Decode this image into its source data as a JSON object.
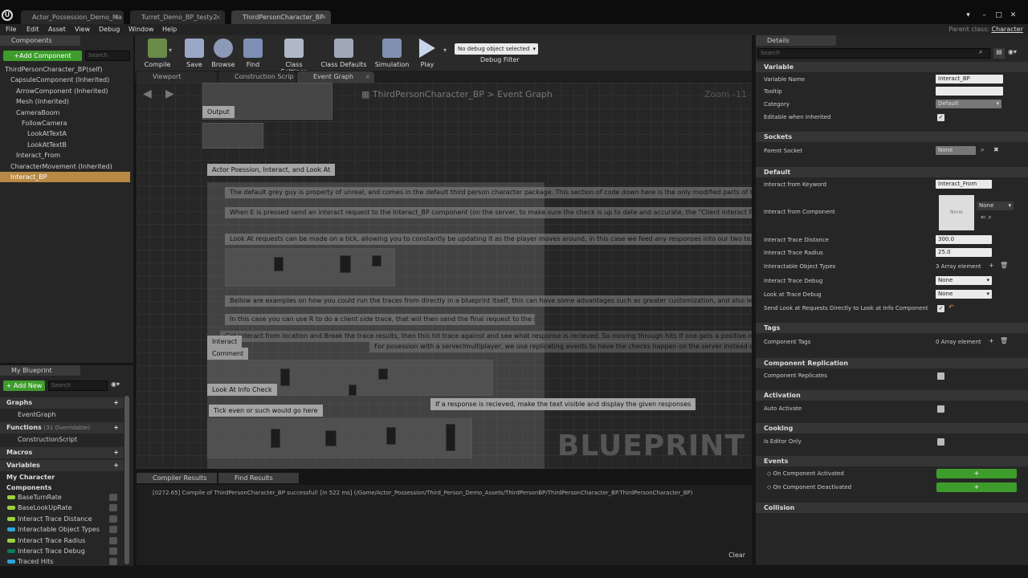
{
  "window": {
    "tabs": [
      "Actor_Possession_Demo_Ma",
      "Turret_Demo_BP_testy2",
      "ThirdPersonCharacter_BP"
    ],
    "active_tab": 2
  },
  "menu": {
    "items": [
      "File",
      "Edit",
      "Asset",
      "View",
      "Debug",
      "Window",
      "Help"
    ],
    "parent_class_label": "Parent class:",
    "parent_class_value": "Character"
  },
  "components": {
    "tab_label": "Components",
    "add_label": "+Add Component",
    "search_placeholder": "Search",
    "items": [
      {
        "label": "ThirdPersonCharacter_BP(self)",
        "indent": 0
      },
      {
        "label": "CapsuleComponent (Inherited)",
        "indent": 1
      },
      {
        "label": "ArrowComponent (Inherited)",
        "indent": 2
      },
      {
        "label": "Mesh (Inherited)",
        "indent": 2
      },
      {
        "label": "CameraBoom",
        "indent": 2
      },
      {
        "label": "FollowCamera",
        "indent": 3
      },
      {
        "label": "LookAtTextA",
        "indent": 4
      },
      {
        "label": "LookAtTextB",
        "indent": 4
      },
      {
        "label": "Interact_From",
        "indent": 2
      },
      {
        "label": "CharacterMovement (Inherited)",
        "indent": 1
      },
      {
        "label": "Interact_BP",
        "indent": 1
      }
    ],
    "selected": 10
  },
  "toolbar": {
    "buttons": [
      "Compile",
      "Save",
      "Browse",
      "Find",
      "Class Settings",
      "Class Defaults",
      "Simulation",
      "Play"
    ],
    "debug_select": "No debug object selected",
    "debug_filter": "Debug Filter"
  },
  "graph_tabs": [
    "Viewport",
    "Construction Scrip",
    "Event Graph"
  ],
  "graph": {
    "breadcrumb_root": "ThirdPersonCharacter_BP",
    "breadcrumb_leaf": "Event Graph",
    "zoom": "Zoom -11",
    "watermark": "BLUEPRINT",
    "comments": {
      "output": "Output",
      "main_title": "Actor Poession, Interact, and Look At",
      "desc1": "The default grey guy is property of unreal, and comes in the default third person character package. This section of code down here is the only modified parts of this actor o",
      "desc2": "When E is pressed send an interact request to the Interact_BP component (on the server, to make sure the check is up to date and accurate, the \"Client Interact Request\" ev",
      "desc3": "Look At requests can be made on a tick, allowing you to constantly be updating it as the player moves around, in this case we feed any responses into our two text",
      "desc4": "Bellow are examples on how you could run the traces from directly in a blueprint itself, this can have some advantages such as greater customization, and also letting you",
      "desc5": "In this case you can use R to do a client side trace, that will then send the final request to the server.",
      "desc6": "Get interact from location and Break the trace results, then this hit trace against and see what response is recieved. So moving through hits if one gets a positive re",
      "desc7": "For posession with a server/multiplayer, we use replicating events to have the checks happen on the server instead of the c",
      "interact": "Interact",
      "comment": "Comment",
      "look_at": "Look At Info Check",
      "tick": "Tick even or such would go here",
      "response": "If a response is recieved, make the text visible and display the given responses"
    }
  },
  "bottom": {
    "tabs": [
      "Compiler Results",
      "Find Results"
    ],
    "log": "[0272.65] Compile of ThirdPersonCharacter_BP successful! [in 522 ms] (/Game/Actor_Possession/Third_Person_Demo_Assets/ThirdPersonBP/ThirdPersonCharacter_BP.ThirdPersonCharacter_BP)",
    "clear": "Clear"
  },
  "my_blueprint": {
    "tab_label": "My Blueprint",
    "add_label": "+ Add New",
    "search_placeholder": "Search",
    "graphs_label": "Graphs",
    "event_graph": "EventGraph",
    "functions_label": "Functions",
    "functions_count": "(31 Overridable)",
    "construction_script": "ConstructionScript",
    "macros_label": "Macros",
    "variables_label": "Variables",
    "my_character": "My Character",
    "components_label": "Components",
    "variables": [
      {
        "label": "BaseTurnRate",
        "color": "#9bd23a"
      },
      {
        "label": "BaseLookUpRate",
        "color": "#9bd23a"
      },
      {
        "label": "Interact Trace Distance",
        "color": "#9bd23a"
      },
      {
        "label": "Interactable Object Types",
        "color": "#2aa7d6"
      },
      {
        "label": "Interact Trace Radius",
        "color": "#9bd23a"
      },
      {
        "label": "Interact Trace Debug",
        "color": "#0a7a5a"
      },
      {
        "label": "Traced Hits",
        "color": "#2aa7d6"
      }
    ]
  },
  "details": {
    "tab_label": "Details",
    "search_placeholder": "Search",
    "variable": {
      "title": "Variable",
      "name_label": "Variable Name",
      "name_value": "Interact_BP",
      "tooltip_label": "Tooltip",
      "category_label": "Category",
      "category_value": "Default",
      "editable_label": "Editable when Inherited"
    },
    "sockets": {
      "title": "Sockets",
      "parent_label": "Parent Socket",
      "parent_value": "None"
    },
    "default": {
      "title": "Default",
      "keyword_label": "Interact from Keyword",
      "keyword_value": "Interact_From",
      "component_label": "Interact from Component",
      "component_thumb": "None",
      "component_value": "None",
      "distance_label": "Interact Trace Distance",
      "distance_value": "300.0",
      "radius_label": "Interact Trace Radius",
      "radius_value": "25.0",
      "types_label": "Interactable Object Types",
      "types_value": "3 Array element",
      "trace_debug_label": "Interact Trace Debug",
      "trace_debug_value": "None",
      "look_debug_label": "Look at Trace Debug",
      "look_debug_value": "None",
      "send_label": "Send Look at Requests Directly to Look at Info Component"
    },
    "tags": {
      "title": "Tags",
      "label": "Component Tags",
      "value": "0 Array element"
    },
    "replication": {
      "title": "Component Replication",
      "label": "Component Replicates"
    },
    "activation": {
      "title": "Activation",
      "label": "Auto Activate"
    },
    "cooking": {
      "title": "Cooking",
      "label": "Is Editor Only"
    },
    "events": {
      "title": "Events",
      "activated": "On Component Activated",
      "deactivated": "On Component Deactivated",
      "add_symbol": "+"
    },
    "collision": {
      "title": "Collision"
    }
  }
}
